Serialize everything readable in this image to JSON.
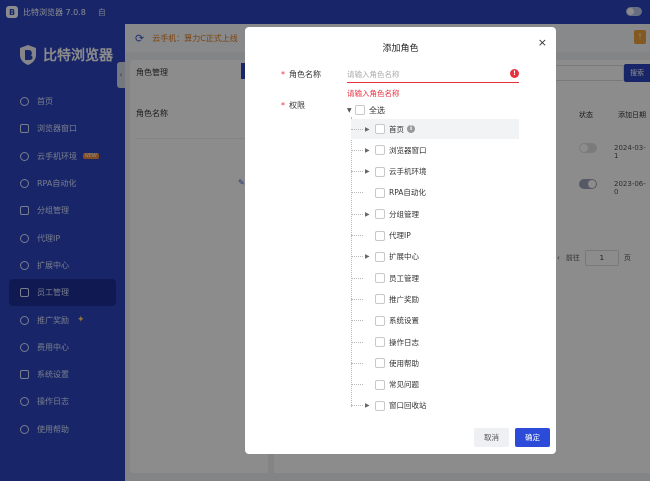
{
  "app": {
    "title": "比特浏览器 7.0.8",
    "title_extra": "自"
  },
  "brand": {
    "name": "比特浏览器"
  },
  "nav": [
    {
      "label": "首页",
      "icon": "home-icon"
    },
    {
      "label": "浏览器窗口",
      "icon": "window-icon"
    },
    {
      "label": "云手机环境",
      "icon": "cloud-icon",
      "badge": "NEW"
    },
    {
      "label": "RPA自动化",
      "icon": "rpa-icon"
    },
    {
      "label": "分组管理",
      "icon": "group-icon"
    },
    {
      "label": "代理IP",
      "icon": "location-icon"
    },
    {
      "label": "扩展中心",
      "icon": "extension-icon"
    },
    {
      "label": "员工管理",
      "icon": "staff-icon",
      "active": true
    },
    {
      "label": "推广奖励",
      "icon": "gift-icon",
      "spark": "✦"
    },
    {
      "label": "费用中心",
      "icon": "billing-icon"
    },
    {
      "label": "系统设置",
      "icon": "settings-icon"
    },
    {
      "label": "操作日志",
      "icon": "log-icon"
    },
    {
      "label": "使用帮助",
      "icon": "help-icon"
    }
  ],
  "notice": {
    "text": "云手机：算力C正式上线"
  },
  "left_panel": {
    "header": "角色管理",
    "column": "角色名称"
  },
  "right_panel": {
    "search_button": "搜索",
    "columns": {
      "status": "状态",
      "created": "添加日期"
    },
    "rows": [
      {
        "status_on": false,
        "date": "2024-03-1"
      },
      {
        "status_on": true,
        "date": "2023-06-0"
      }
    ],
    "pager": {
      "prefix": "前往",
      "page": "1",
      "suffix": "页"
    }
  },
  "dialog": {
    "title": "添加角色",
    "close": "×",
    "name_label": "角色名称",
    "name_placeholder": "请输入角色名称",
    "name_error": "请输入角色名称",
    "perm_label": "权限",
    "select_all": "全选",
    "permissions": [
      {
        "label": "首页",
        "expandable": true,
        "info": true
      },
      {
        "label": "浏览器窗口",
        "expandable": true
      },
      {
        "label": "云手机环境",
        "expandable": true
      },
      {
        "label": "RPA自动化",
        "expandable": false
      },
      {
        "label": "分组管理",
        "expandable": true
      },
      {
        "label": "代理IP",
        "expandable": false
      },
      {
        "label": "扩展中心",
        "expandable": true
      },
      {
        "label": "员工管理",
        "expandable": false
      },
      {
        "label": "推广奖励",
        "expandable": false
      },
      {
        "label": "系统设置",
        "expandable": false
      },
      {
        "label": "操作日志",
        "expandable": false
      },
      {
        "label": "使用帮助",
        "expandable": false
      },
      {
        "label": "常见问题",
        "expandable": false
      },
      {
        "label": "窗口回收站",
        "expandable": true
      }
    ],
    "cancel": "取消",
    "confirm": "确定"
  },
  "colors": {
    "primary": "#2c45c0",
    "error": "#e8313f",
    "button": "#2b4bd8"
  }
}
